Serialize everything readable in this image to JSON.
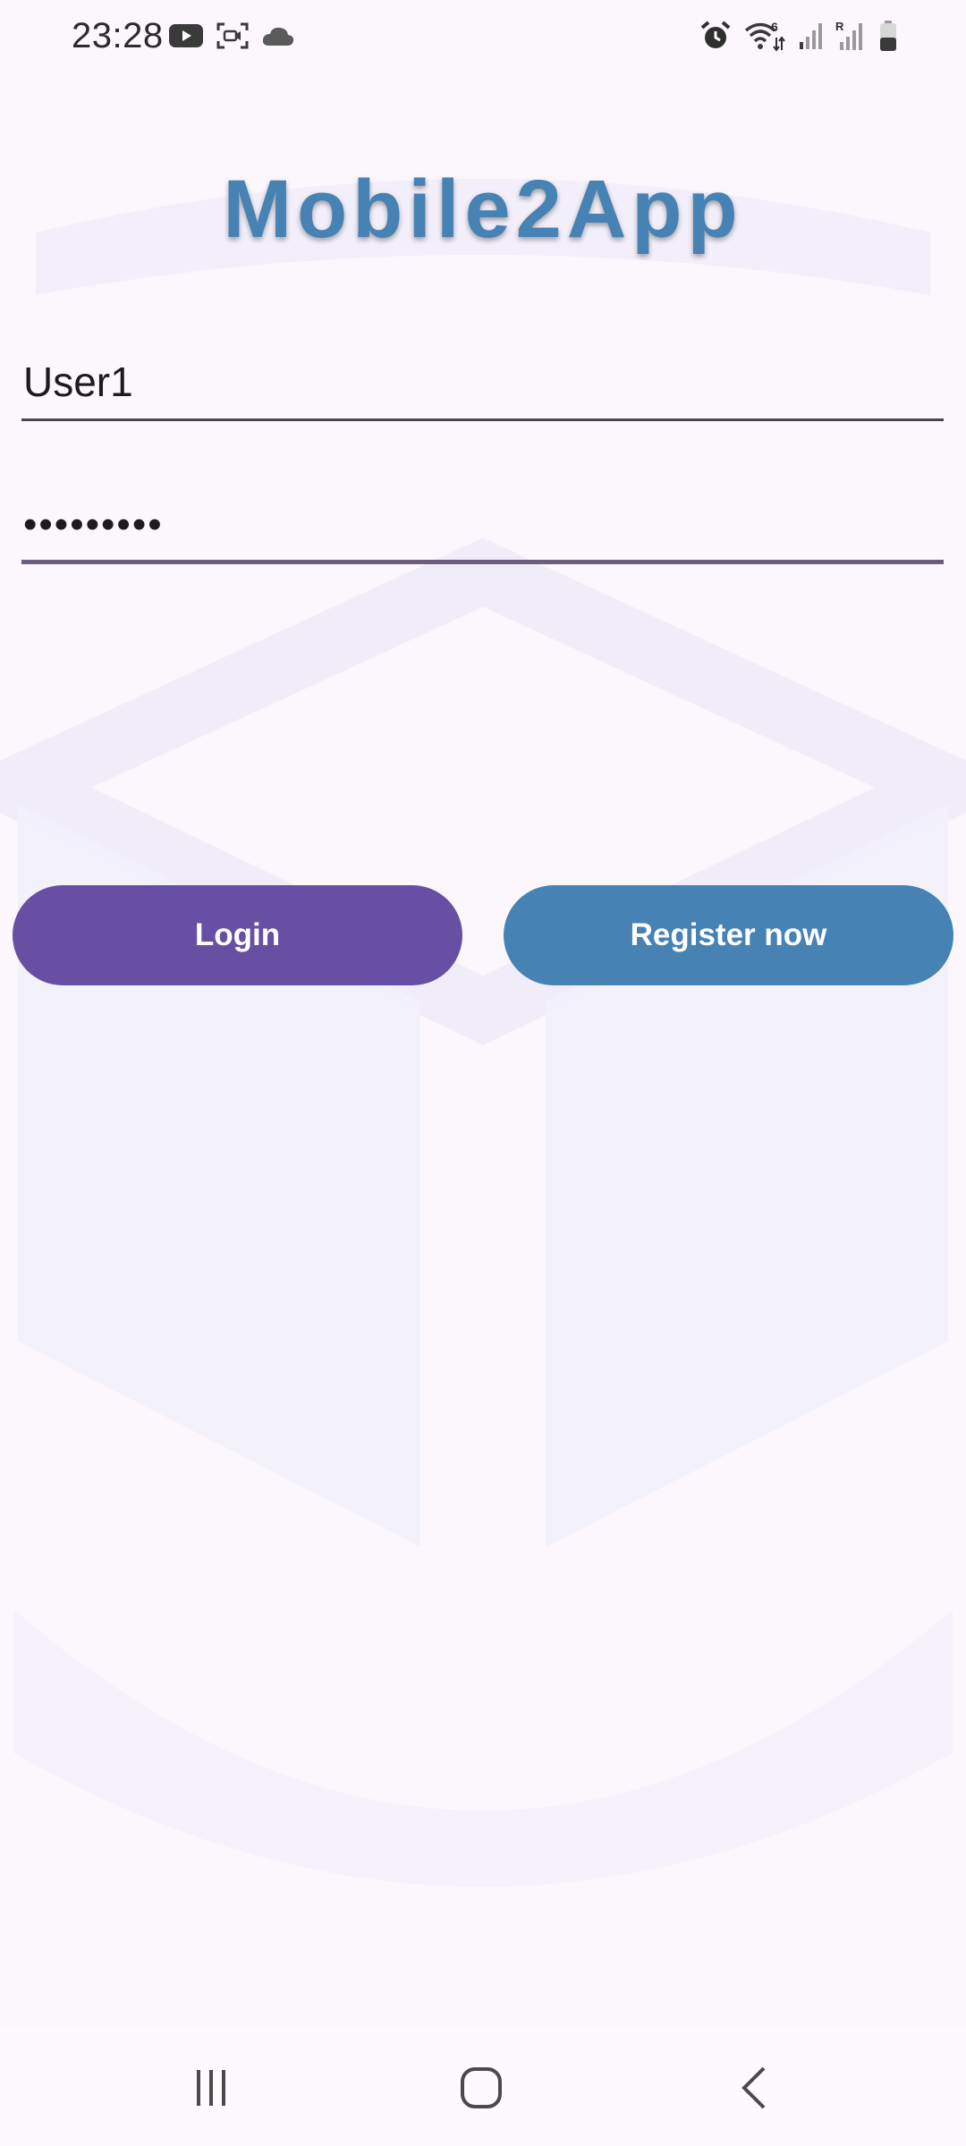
{
  "status_bar": {
    "time": "23:28",
    "left_icons": [
      "youtube-icon",
      "screen-recorder-icon",
      "cloud-icon"
    ],
    "right_icons": [
      "alarm-icon",
      "wifi-icon",
      "signal-icon",
      "signal-roaming-icon",
      "battery-icon"
    ],
    "wifi_badge": "6",
    "roaming_badge": "R"
  },
  "app": {
    "title": "Mobile2App",
    "title_color": "#4682b4"
  },
  "form": {
    "username_value": "User1",
    "password_value": "•••••••••"
  },
  "buttons": {
    "login_label": "Login",
    "login_color": "#6750a4",
    "register_label": "Register now",
    "register_color": "#4682b4"
  },
  "nav_bar": {
    "items": [
      "recents-icon",
      "home-icon",
      "back-icon"
    ]
  }
}
